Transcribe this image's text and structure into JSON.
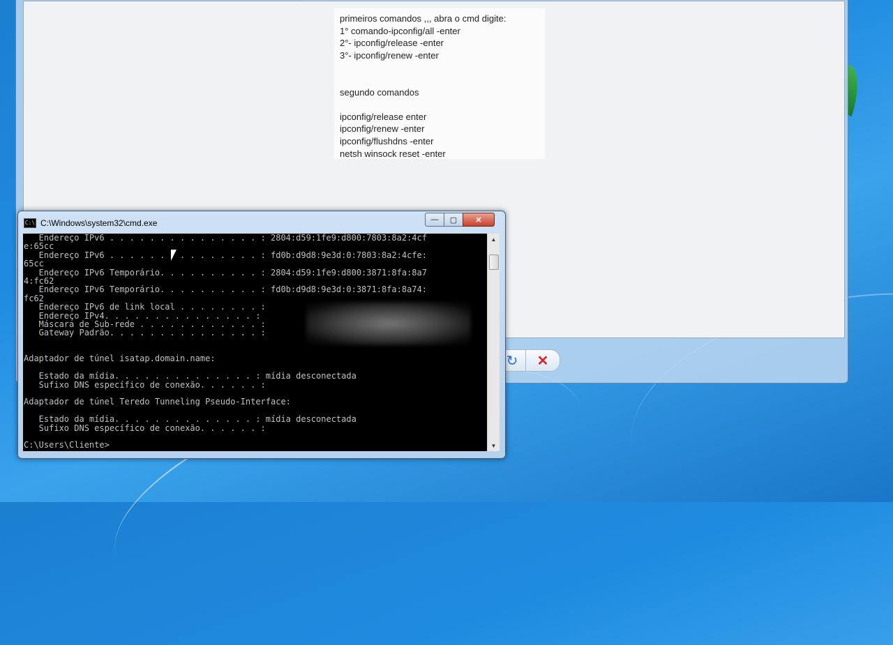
{
  "note": {
    "lines": [
      "primeiros comandos ,,, abra o cmd digite:",
      "1° comando-ipconfig/all -enter",
      "2°- ipconfig/release -enter",
      "3°- ipconfig/renew -enter",
      "",
      "",
      "segundo comandos",
      "",
      "ipconfig/release enter",
      "ipconfig/renew -enter",
      "ipconfig/flushdns -enter",
      "netsh winsock reset -enter"
    ]
  },
  "toolbar": {
    "refresh_icon": "↻",
    "stop_icon": "✕"
  },
  "cmd": {
    "title": "C:\\Windows\\system32\\cmd.exe",
    "caption": {
      "minimize": "—",
      "maximize": "▢",
      "close": "✕"
    },
    "lines": [
      "   Endereço IPv6 . . . . . . . . . . . . . . . : 2804:d59:1fe9:d800:7803:8a2:4cf",
      "e:65cc",
      "   Endereço IPv6 . . . . . . . . . . . . . . . : fd0b:d9d8:9e3d:0:7803:8a2:4cfe:",
      "65cc",
      "   Endereço IPv6 Temporário. . . . . . . . . . : 2804:d59:1fe9:d800:3871:8fa:8a7",
      "4:fc62",
      "   Endereço IPv6 Temporário. . . . . . . . . . : fd0b:d9d8:9e3d:0:3871:8fa:8a74:",
      "fc62",
      "   Endereço IPv6 de link local . . . . . . . . :",
      "   Endereço IPv4. . . . . . . . . . . . . . . :",
      "   Máscara de Sub-rede . . . . . . . . . . . . :",
      "   Gateway Padrão. . . . . . . . . . . . . . . :",
      "",
      "",
      "Adaptador de túnel isatap.domain.name:",
      "",
      "   Estado da mídia. . . . . . . . . . . . . . : mídia desconectada",
      "   Sufixo DNS específico de conexão. . . . . . :",
      "",
      "Adaptador de túnel Teredo Tunneling Pseudo-Interface:",
      "",
      "   Estado da mídia. . . . . . . . . . . . . . : mídia desconectada",
      "   Sufixo DNS específico de conexão. . . . . . :",
      "",
      "C:\\Users\\Cliente>"
    ]
  }
}
